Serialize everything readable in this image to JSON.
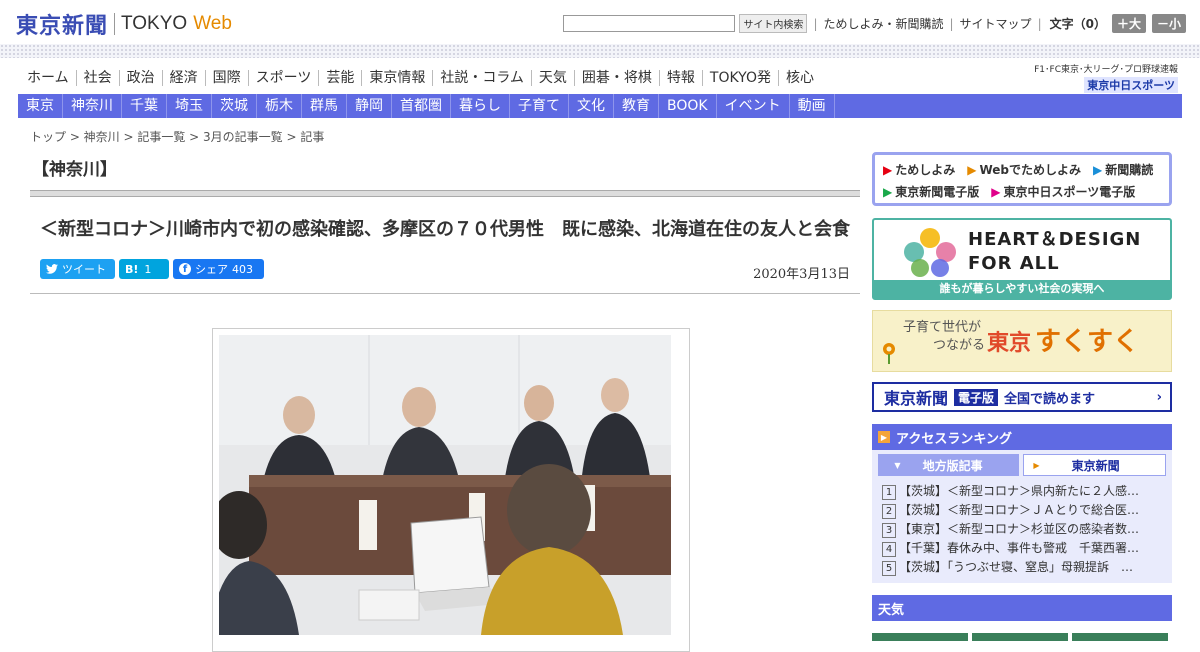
{
  "header": {
    "logo_jp": "東京新聞",
    "logo_en": "TOKYO",
    "logo_web": "Web",
    "search_button": "サイト内検索",
    "links": [
      "ためしよみ・新聞購読",
      "サイトマップ"
    ],
    "font_size_label": "文字（0）",
    "font_plus": "＋大",
    "font_minus": "－小"
  },
  "nav_main": [
    "ホーム",
    "社会",
    "政治",
    "経済",
    "国際",
    "スポーツ",
    "芸能",
    "東京情報",
    "社説・コラム",
    "天気",
    "囲碁・将棋",
    "特報",
    "TOKYO発",
    "核心"
  ],
  "chunichi": {
    "top": "F1･FC東京･大リーグ･プロ野球速報",
    "logo": "東京中日スポーツ"
  },
  "nav_region": [
    "東京",
    "神奈川",
    "千葉",
    "埼玉",
    "茨城",
    "栃木",
    "群馬",
    "静岡",
    "首都圏",
    "暮らし",
    "子育て",
    "文化",
    "教育",
    "BOOK",
    "イベント",
    "動画"
  ],
  "breadcrumb": "トップ > 神奈川 > 記事一覧 > 3月の記事一覧 > 記事",
  "article": {
    "section": "【神奈川】",
    "headline": "＜新型コロナ＞川崎市内で初の感染確認、多摩区の７０代男性　既に感染、北海道在住の友人と会食",
    "date": "2020年3月13日",
    "share": {
      "tweet": "ツイート",
      "hatena": "B!",
      "hatena_count": "1",
      "facebook": "シェア",
      "facebook_count": "403"
    }
  },
  "sidebar": {
    "links_row1": [
      "ためしよみ",
      "Webでためしよみ",
      "新聞購読"
    ],
    "links_row2": [
      "東京新聞電子版",
      "東京中日スポーツ電子版"
    ],
    "hd_title1": "HEART＆DESIGN",
    "hd_title2": "FOR ALL",
    "hd_foot": "誰もが暮らしやすい社会の実現へ",
    "sk_small1": "子育て世代が",
    "sk_small2": "つながる",
    "sk_tokyo": "東京",
    "sk_big": "すくすく",
    "ep_logo": "東京新聞",
    "ep_tag": "電子版",
    "ep_text": "全国で読めます",
    "ranking_title": "アクセスランキング",
    "ranking_tab_a": "地方版記事",
    "ranking_tab_b": "東京新聞",
    "ranking": [
      "【茨城】＜新型コロナ＞県内新たに２人感…",
      "【茨城】＜新型コロナ＞ＪＡとりで総合医…",
      "【東京】＜新型コロナ＞杉並区の感染者数…",
      "【千葉】春休み中、事件も警戒　千葉西署…",
      "【茨城】「うつぶせ寝、窒息」母親提訴　…"
    ],
    "weather_title": "天気"
  }
}
